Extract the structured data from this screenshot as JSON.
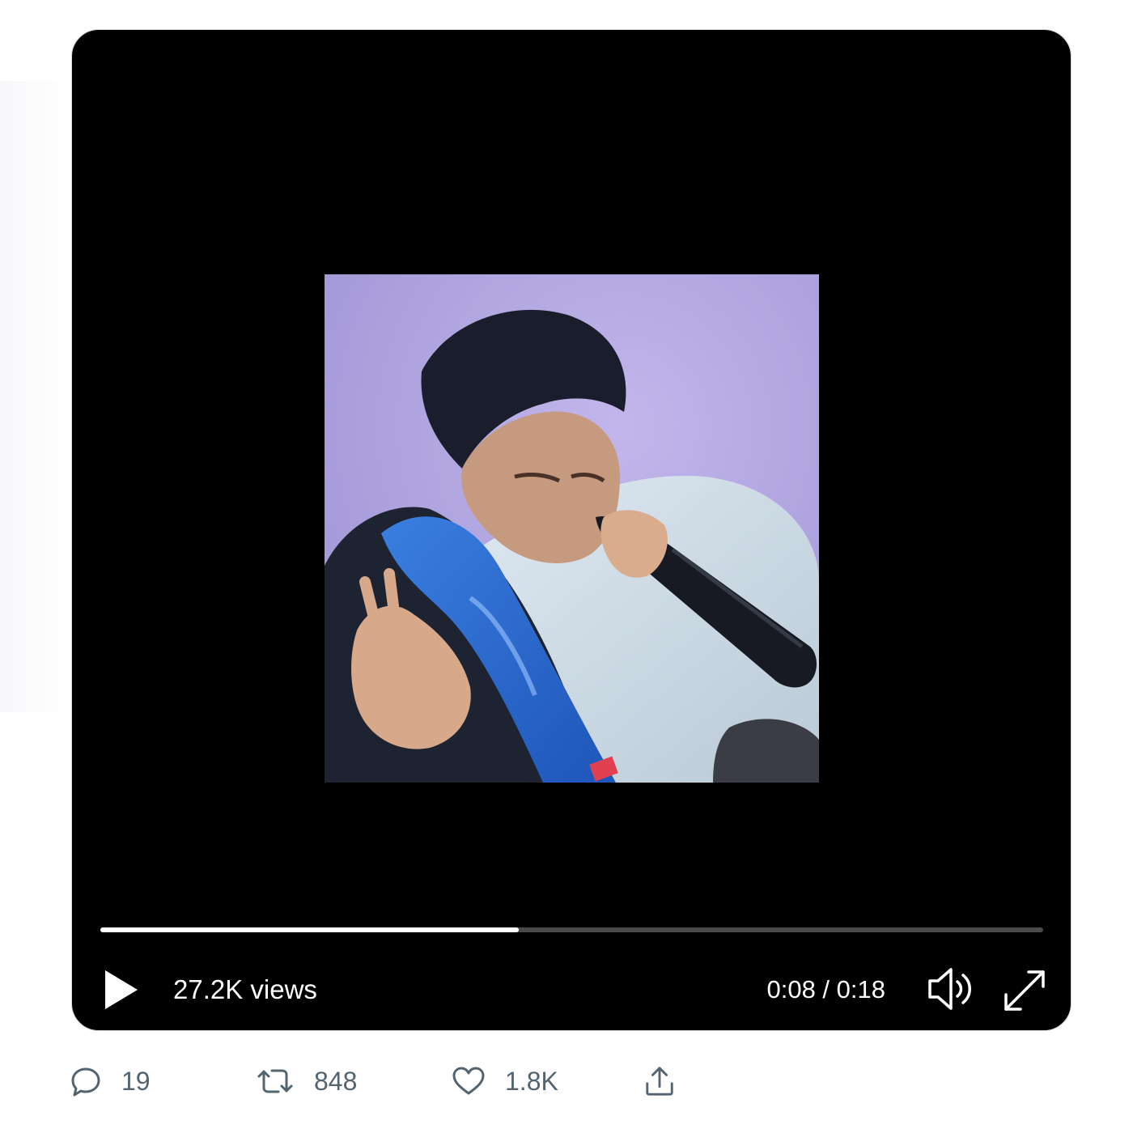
{
  "player": {
    "views_label": "27.2K views",
    "time_label": "0:08 / 0:18",
    "progress_fraction": 0.444,
    "colors": {
      "background": "#000000",
      "progress_played": "#ffffff",
      "progress_remaining": "#4a4a4a",
      "controls": "#ffffff"
    },
    "icons": {
      "play": "play-icon",
      "volume": "volume-icon",
      "fullscreen": "fullscreen-expand-icon"
    }
  },
  "actions": {
    "reply": {
      "icon": "reply-icon",
      "count": "19"
    },
    "retweet": {
      "icon": "retweet-icon",
      "count": "848"
    },
    "like": {
      "icon": "heart-icon",
      "count": "1.8K"
    },
    "share": {
      "icon": "share-icon"
    },
    "color": "#536471"
  }
}
